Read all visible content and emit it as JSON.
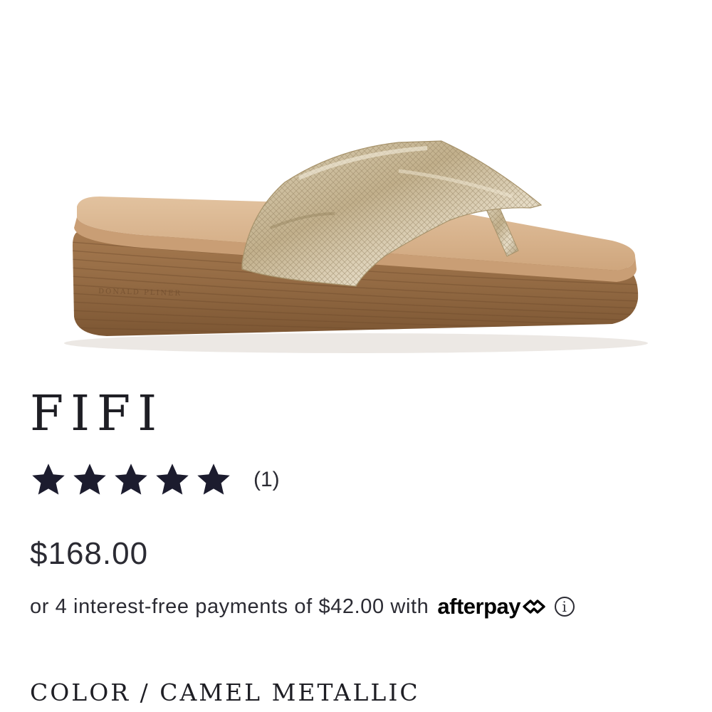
{
  "product": {
    "image_alt": "Camel metallic platform thong sandal",
    "brand_stamp": "DONALD PLINER",
    "name": "FIFI",
    "rating": {
      "stars": 5,
      "max_stars": 5,
      "count_text": "(1)"
    },
    "price": "$168.00",
    "installments": {
      "text": "or 4 interest-free payments of $42.00 with",
      "provider": "afterpay",
      "provider_icon": "afterpay-arrows-icon",
      "info_icon": "info-circle-icon",
      "info_glyph": "i"
    },
    "color": {
      "label": "COLOR / CAMEL METALLIC"
    }
  },
  "colors": {
    "text": "#2b2b33",
    "stars": "#1c1c2e",
    "sole": "#9c7048",
    "footbed": "#d9b48f",
    "strap": "#cfc2a6"
  }
}
